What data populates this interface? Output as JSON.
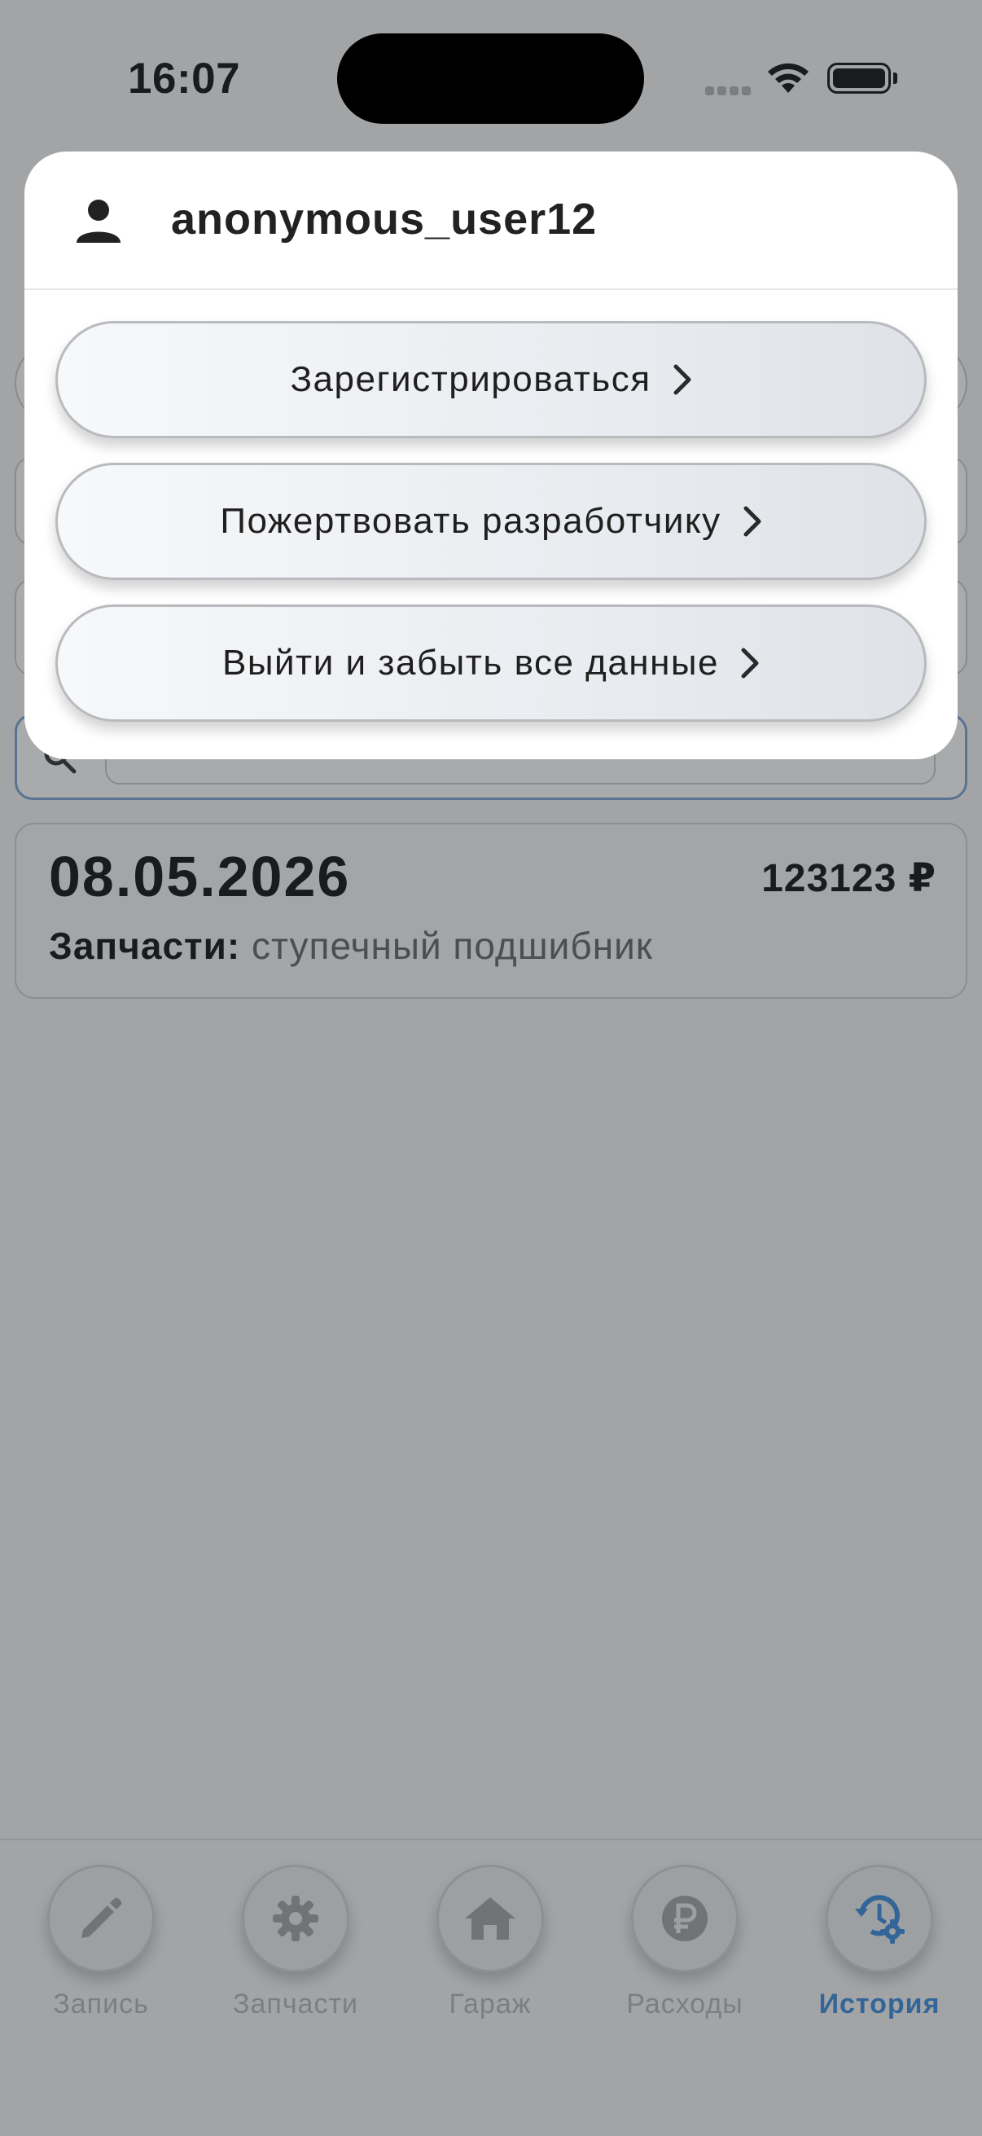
{
  "status_bar": {
    "time": "16:07"
  },
  "popup": {
    "username": "anonymous_user12",
    "icons": {
      "user": "person-icon",
      "chevron": "chevron-right-icon"
    },
    "items": [
      {
        "label": "Зарегистрироваться"
      },
      {
        "label": "Пожертвовать разработчику"
      },
      {
        "label": "Выйти и забыть все данные"
      }
    ]
  },
  "record": {
    "date": "08.05.2026",
    "amount": "123123 ₽",
    "category_label": "Запчасти:",
    "category_value": "ступечный подшибник"
  },
  "tabbar": {
    "active_color": "#3d8ce0",
    "tabs": [
      {
        "label": "Запись",
        "icon": "pencil-icon"
      },
      {
        "label": "Запчасти",
        "icon": "gear-icon"
      },
      {
        "label": "Гараж",
        "icon": "home-icon"
      },
      {
        "label": "Расходы",
        "icon": "ruble-icon"
      },
      {
        "label": "История",
        "icon": "history-settings-icon",
        "active": true
      }
    ]
  }
}
